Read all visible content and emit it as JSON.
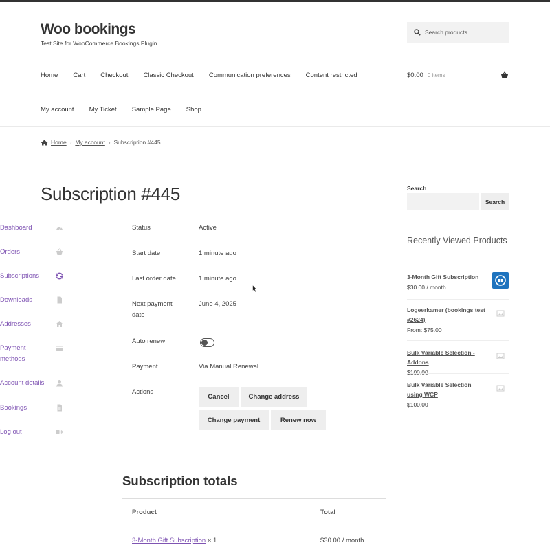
{
  "site": {
    "title": "Woo bookings",
    "tagline": "Test Site for WooCommerce Bookings Plugin"
  },
  "header_search": {
    "placeholder": "Search products…",
    "icon": "search-icon"
  },
  "primary_nav": {
    "row1": [
      "Home",
      "Cart",
      "Checkout",
      "Classic Checkout",
      "Communication preferences",
      "Content restricted"
    ],
    "row2": [
      "My account",
      "My Ticket",
      "Sample Page",
      "Shop"
    ]
  },
  "cart": {
    "amount": "$0.00",
    "count": "0 items",
    "icon": "basket-icon"
  },
  "breadcrumb": {
    "home": "Home",
    "account": "My account",
    "current": "Subscription #445",
    "separator": "›"
  },
  "page_title": "Subscription #445",
  "account_nav": [
    {
      "label": "Dashboard",
      "icon": "dashboard-icon"
    },
    {
      "label": "Orders",
      "icon": "basket-icon"
    },
    {
      "label": "Subscriptions",
      "icon": "refresh-icon"
    },
    {
      "label": "Downloads",
      "icon": "file-icon"
    },
    {
      "label": "Addresses",
      "icon": "house-icon"
    },
    {
      "label": "Payment methods",
      "icon": "credit-card-icon"
    },
    {
      "label": "Account details",
      "icon": "user-icon"
    },
    {
      "label": "Bookings",
      "icon": "file-icon"
    },
    {
      "label": "Log out",
      "icon": "sign-out-icon"
    }
  ],
  "subscription": {
    "status_label": "Status",
    "status": "Active",
    "start_label": "Start date",
    "start": "1 minute ago",
    "last_order_label": "Last order date",
    "last_order": "1 minute ago",
    "next_payment_label": "Next payment date",
    "next_payment": "June 4, 2025",
    "auto_renew_label": "Auto renew",
    "auto_renew_on": false,
    "payment_label": "Payment",
    "payment": "Via Manual Renewal",
    "actions_label": "Actions",
    "actions": [
      "Cancel",
      "Change address",
      "Change payment",
      "Renew now"
    ]
  },
  "totals": {
    "title": "Subscription totals",
    "col_product": "Product",
    "col_total": "Total",
    "row_product": "3-Month Gift Subscription",
    "row_qty": " × 1",
    "row_total": "$30.00 / month"
  },
  "sidebar": {
    "search_label": "Search",
    "search_button": "Search",
    "recently_viewed_title": "Recently Viewed Products",
    "products": [
      {
        "name": "3-Month Gift Subscription",
        "price": "$30.00 / month"
      },
      {
        "name": "Logeerkamer (bookings test #2624)",
        "price": "From: $75.00"
      },
      {
        "name": "Bulk Variable Selection - Addons",
        "price": "$100.00"
      },
      {
        "name": "Bulk Variable Selection using WCP",
        "price": "$100.00"
      }
    ]
  },
  "colors": {
    "link_purple": "#7f54b3",
    "product_thumb_blue": "#1e73be"
  }
}
